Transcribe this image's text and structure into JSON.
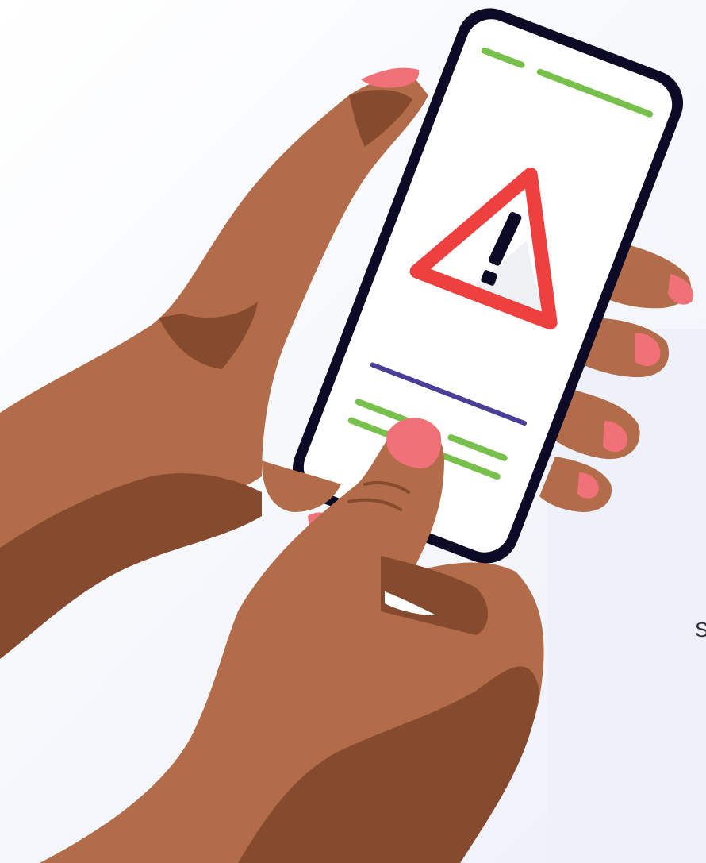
{
  "illustration": {
    "subject": "hands-holding-phone-with-warning-alert",
    "warning_icon": "warning-triangle-icon",
    "edge_text": "S"
  },
  "colors": {
    "skin": "#b26c4a",
    "skin_shadow": "#864a2e",
    "nail": "#f07177",
    "phone_frame": "#0d0a26",
    "screen": "#ffffff",
    "accent_green": "#77c04b",
    "accent_purple": "#493e98",
    "warning_red": "#ef4040"
  }
}
